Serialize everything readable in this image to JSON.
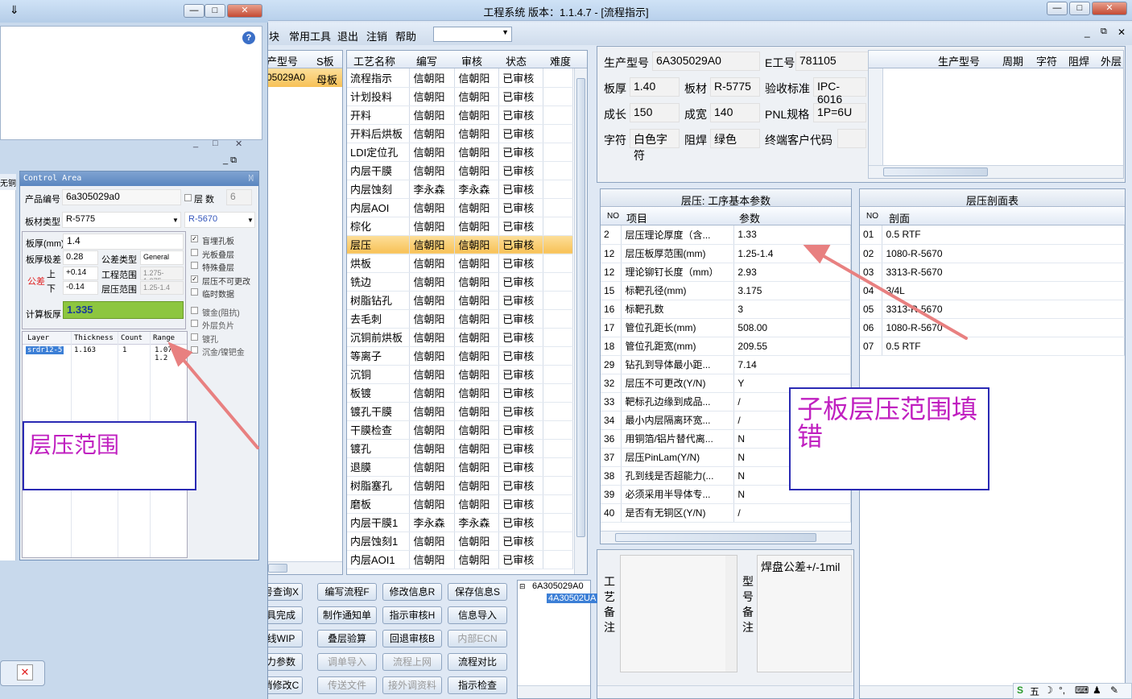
{
  "app_title": "工程系统   版本：1.1.4.7 - [流程指示]",
  "menu": [
    "块",
    "常用工具",
    "退出",
    "注销",
    "帮助"
  ],
  "left_list": {
    "headers": [
      "产型号",
      "S板"
    ],
    "row": [
      "05029A0",
      "母板"
    ]
  },
  "process_grid": {
    "headers": [
      "工艺名称",
      "编写",
      "审核",
      "状态",
      "难度"
    ],
    "rows": [
      [
        "流程指示",
        "信朝阳",
        "信朝阳",
        "已审核"
      ],
      [
        "计划投料",
        "信朝阳",
        "信朝阳",
        "已审核"
      ],
      [
        "开料",
        "信朝阳",
        "信朝阳",
        "已审核"
      ],
      [
        "开料后烘板",
        "信朝阳",
        "信朝阳",
        "已审核"
      ],
      [
        "LDI定位孔",
        "信朝阳",
        "信朝阳",
        "已审核"
      ],
      [
        "内层干膜",
        "信朝阳",
        "信朝阳",
        "已审核"
      ],
      [
        "内层蚀刻",
        "李永森",
        "李永森",
        "已审核"
      ],
      [
        "内层AOI",
        "信朝阳",
        "信朝阳",
        "已审核"
      ],
      [
        "棕化",
        "信朝阳",
        "信朝阳",
        "已审核"
      ],
      [
        "层压",
        "信朝阳",
        "信朝阳",
        "已审核"
      ],
      [
        "烘板",
        "信朝阳",
        "信朝阳",
        "已审核"
      ],
      [
        "铣边",
        "信朝阳",
        "信朝阳",
        "已审核"
      ],
      [
        "树脂钻孔",
        "信朝阳",
        "信朝阳",
        "已审核"
      ],
      [
        "去毛刺",
        "信朝阳",
        "信朝阳",
        "已审核"
      ],
      [
        "沉铜前烘板",
        "信朝阳",
        "信朝阳",
        "已审核"
      ],
      [
        "等离子",
        "信朝阳",
        "信朝阳",
        "已审核"
      ],
      [
        "沉铜",
        "信朝阳",
        "信朝阳",
        "已审核"
      ],
      [
        "板镀",
        "信朝阳",
        "信朝阳",
        "已审核"
      ],
      [
        "镀孔干膜",
        "信朝阳",
        "信朝阳",
        "已审核"
      ],
      [
        "干膜检查",
        "信朝阳",
        "信朝阳",
        "已审核"
      ],
      [
        "镀孔",
        "信朝阳",
        "信朝阳",
        "已审核"
      ],
      [
        "退膜",
        "信朝阳",
        "信朝阳",
        "已审核"
      ],
      [
        "树脂塞孔",
        "信朝阳",
        "信朝阳",
        "已审核"
      ],
      [
        "磨板",
        "信朝阳",
        "信朝阳",
        "已审核"
      ],
      [
        "内层干膜1",
        "李永森",
        "李永森",
        "已审核"
      ],
      [
        "内层蚀刻1",
        "信朝阳",
        "信朝阳",
        "已审核"
      ],
      [
        "内层AOI1",
        "信朝阳",
        "信朝阳",
        "已审核"
      ]
    ],
    "selected_index": 9
  },
  "info": {
    "prod_label": "生产型号",
    "prod_value": "6A305029A0",
    "eno_label": "E工号",
    "eno_value": "781105",
    "thick_label": "板厚",
    "thick_value": "1.40",
    "mat_label": "板材",
    "mat_value": "R-5775",
    "std_label": "验收标准",
    "std_value": "IPC-6016",
    "len_label": "成长",
    "len_value": "150",
    "wid_label": "成宽",
    "wid_value": "140",
    "pnl_label": "PNL规格",
    "pnl_value": "1P=6U",
    "char_label": "字符",
    "char_value": "白色字符",
    "mask_label": "阻焊",
    "mask_value": "绿色",
    "cust_label": "终端客户代码"
  },
  "right_grid_headers": [
    "生产型号",
    "周期",
    "字符",
    "阻焊",
    "外层"
  ],
  "params": {
    "title": "层压: 工序基本参数",
    "headers": [
      "NO",
      "项目",
      "参数"
    ],
    "rows": [
      [
        "2",
        "层压理论厚度（含...",
        "1.33"
      ],
      [
        "12",
        "层压板厚范围(mm)",
        "1.25-1.4"
      ],
      [
        "12",
        "理论铆钉长度（mm）",
        "2.93"
      ],
      [
        "15",
        "标靶孔径(mm)",
        "3.175"
      ],
      [
        "16",
        "标靶孔数",
        "3"
      ],
      [
        "17",
        "管位孔距长(mm)",
        "508.00"
      ],
      [
        "18",
        "管位孔距宽(mm)",
        "209.55"
      ],
      [
        "29",
        "钻孔到导体最小距...",
        "7.14"
      ],
      [
        "32",
        "层压不可更改(Y/N)",
        "Y"
      ],
      [
        "33",
        "靶标孔边缘到成品...",
        "/"
      ],
      [
        "34",
        "最小内层隔离环宽...",
        "/"
      ],
      [
        "36",
        "用铜箔/铝片替代离...",
        "N"
      ],
      [
        "37",
        "层压PinLam(Y/N)",
        "N"
      ],
      [
        "38",
        "孔到线是否超能力(...",
        "N"
      ],
      [
        "39",
        "必须采用半导体专...",
        "N"
      ],
      [
        "40",
        "是否有无铜区(Y/N)",
        "/"
      ]
    ]
  },
  "stack": {
    "title": "层压剖面表",
    "headers": [
      "NO",
      "剖面"
    ],
    "rows": [
      [
        "01",
        "0.5 RTF"
      ],
      [
        "02",
        "1080-R-5670"
      ],
      [
        "03",
        "3313-R-5670"
      ],
      [
        "04",
        "3/4L"
      ],
      [
        "05",
        "3313-R-5670"
      ],
      [
        "06",
        "1080-R-5670"
      ],
      [
        "07",
        "0.5 RTF"
      ]
    ]
  },
  "remarks": {
    "craft_label": "工艺备注",
    "model_label": "型号备注",
    "model_text": "焊盘公差+/-1mil"
  },
  "buttons": [
    [
      "号查询X",
      "编写流程F",
      "修改信息R",
      "保存信息S"
    ],
    [
      "具完成",
      "制作通知单",
      "指示审核H",
      "信息导入"
    ],
    [
      "线WIP",
      "叠层验算",
      "回退审核B",
      "内部ECN"
    ],
    [
      "力参数",
      "调单导入",
      "流程上网",
      "流程对比"
    ],
    [
      "消修改C",
      "传送文件",
      "接外调资料",
      "指示检查"
    ]
  ],
  "tree": {
    "root": "6A305029A0",
    "child": "4A30502UA"
  },
  "control": {
    "title": "Control Area",
    "prod_label": "产品编号",
    "prod_value": "6a305029a0",
    "layer_label": "层  数",
    "layer_value": "6",
    "mat_label": "板材类型",
    "mat_value": "R-5775",
    "mat2_value": "R-5670",
    "thick_label": "板厚(mm)",
    "thick_value": "1.4",
    "tol_label": "板厚极差",
    "tol_value": "0.28",
    "toltype_label": "公差类型",
    "toltype_value": "General",
    "dev_label": "公差",
    "up_label": "上",
    "down_label": "下",
    "up_value": "+0.14",
    "down_value": "-0.14",
    "eng_label": "工程范围",
    "eng_value": "1.275-1.375",
    "lam_label": "层压范围",
    "lam_value": "1.25-1.4",
    "calc_label": "计算板厚",
    "calc_value": "1.335",
    "checks": [
      "盲埋孔板",
      "光板叠层",
      "特殊叠层",
      "层压不可更改",
      "临时数据",
      "镀金(阻抗)",
      "外层负片",
      "镀孔",
      "沉金/镍钯金"
    ],
    "checked": [
      true,
      false,
      false,
      true,
      false,
      false,
      false,
      false,
      false
    ],
    "layer_headers": [
      "Layer",
      "Thickness",
      "Count",
      "Range"
    ],
    "layer_row": [
      "srdr12-5",
      "1.163",
      "1",
      "1.07-1.2"
    ]
  },
  "annotations": {
    "left": "层压范围",
    "right": "子板层压范围填错"
  },
  "colors": {
    "selected": "#f7c157",
    "calc_bg": "#8dc63f",
    "annotation_text": "#c020c0",
    "annotation_border": "#2a2ab4",
    "arrow": "#e88080"
  }
}
